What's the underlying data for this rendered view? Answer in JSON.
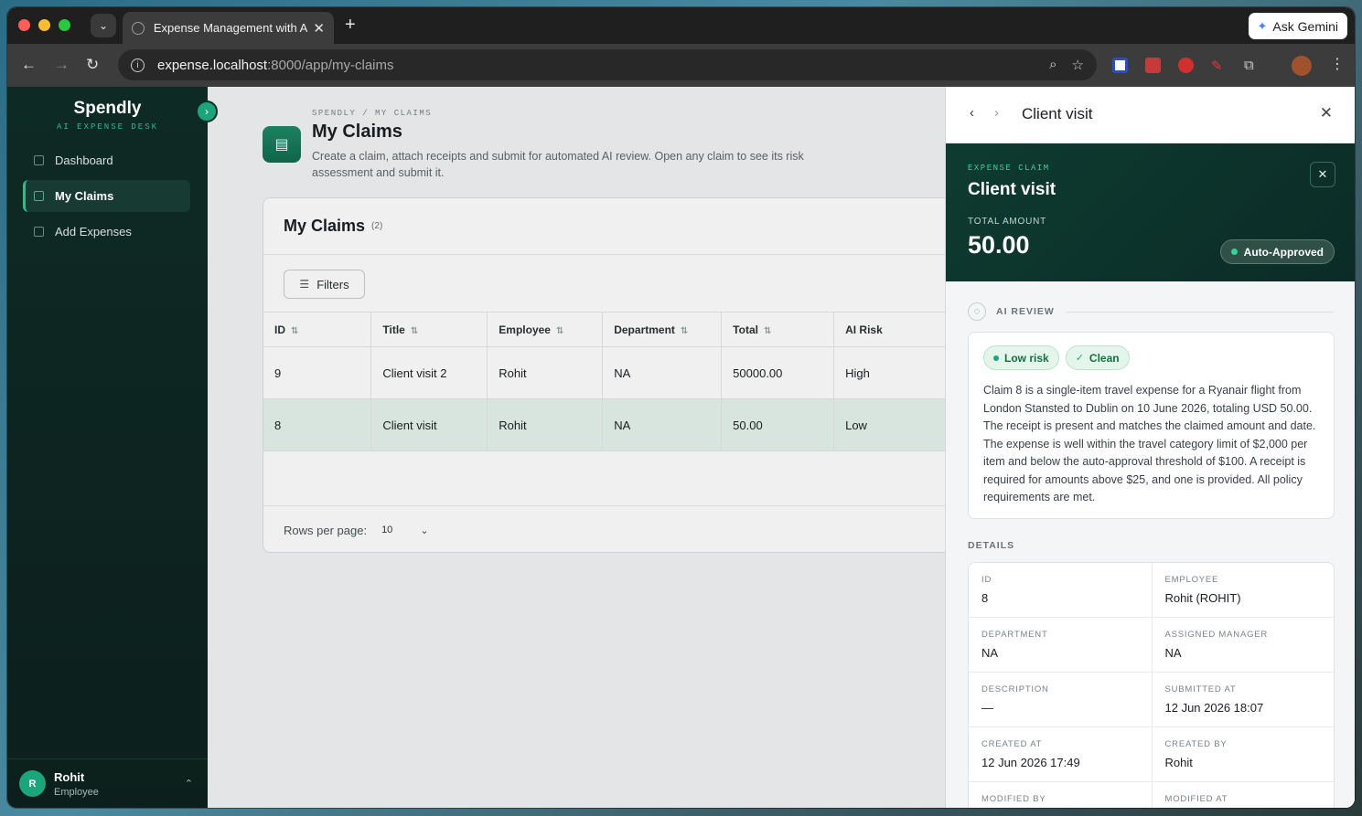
{
  "browser": {
    "tab_title": "Expense Management with AI",
    "url_host": "expense.localhost",
    "url_path": ":8000/app/my-claims",
    "gemini_label": "Ask Gemini"
  },
  "sidebar": {
    "brand": "Spendly",
    "brand_sub": "AI EXPENSE DESK",
    "items": [
      {
        "label": "Dashboard",
        "icon": "grid-icon"
      },
      {
        "label": "My Claims",
        "icon": "document-icon",
        "active": true
      },
      {
        "label": "Add Expenses",
        "icon": "plus-square-icon"
      }
    ],
    "user": {
      "initial": "R",
      "name": "Rohit",
      "role": "Employee"
    }
  },
  "page": {
    "breadcrumb": "SPENDLY / MY CLAIMS",
    "title": "My Claims",
    "description": "Create a claim, attach receipts and submit for automated AI review. Open any claim to see its risk assessment and submit it."
  },
  "claims": {
    "title": "My Claims",
    "count": "(2)",
    "filters_label": "Filters",
    "columns": [
      "ID",
      "Title",
      "Employee",
      "Department",
      "Total",
      "AI Risk"
    ],
    "rows": [
      [
        "9",
        "Client visit 2",
        "Rohit",
        "NA",
        "50000.00",
        "High"
      ],
      [
        "8",
        "Client visit",
        "Rohit",
        "NA",
        "50.00",
        "Low"
      ]
    ],
    "rows_per_page_label": "Rows per page:",
    "rows_per_page": "10"
  },
  "drawer": {
    "title": "Client visit",
    "kicker": "EXPENSE CLAIM",
    "claim_title": "Client visit",
    "total_label": "TOTAL AMOUNT",
    "total": "50.00",
    "status": "Auto-Approved",
    "ai_review_label": "AI REVIEW",
    "risk_chip": "Low risk",
    "clean_chip": "Clean",
    "review_text": "Claim 8 is a single-item travel expense for a Ryanair flight from London Stansted to Dublin on 10 June 2026, totaling USD 50.00. The receipt is present and matches the claimed amount and date. The expense is well within the travel category limit of $2,000 per item and below the auto-approval threshold of $100. A receipt is required for amounts above $25, and one is provided. All policy requirements are met.",
    "details_label": "DETAILS",
    "details": [
      {
        "key": "ID",
        "value": "8"
      },
      {
        "key": "EMPLOYEE",
        "value": "Rohit (ROHIT)"
      },
      {
        "key": "DEPARTMENT",
        "value": "NA"
      },
      {
        "key": "ASSIGNED MANAGER",
        "value": "NA"
      },
      {
        "key": "DESCRIPTION",
        "value": "—"
      },
      {
        "key": "SUBMITTED AT",
        "value": "12 Jun 2026 18:07"
      },
      {
        "key": "CREATED AT",
        "value": "12 Jun 2026 17:49"
      },
      {
        "key": "CREATED BY",
        "value": "Rohit"
      },
      {
        "key": "MODIFIED BY",
        "value": ""
      },
      {
        "key": "MODIFIED AT",
        "value": ""
      }
    ]
  },
  "colors": {
    "accent": "#1aa67a",
    "sidebar_bg": "#0e2a25",
    "hero_bg": "#0e3b30",
    "selected_row": "#e6f4ec"
  }
}
